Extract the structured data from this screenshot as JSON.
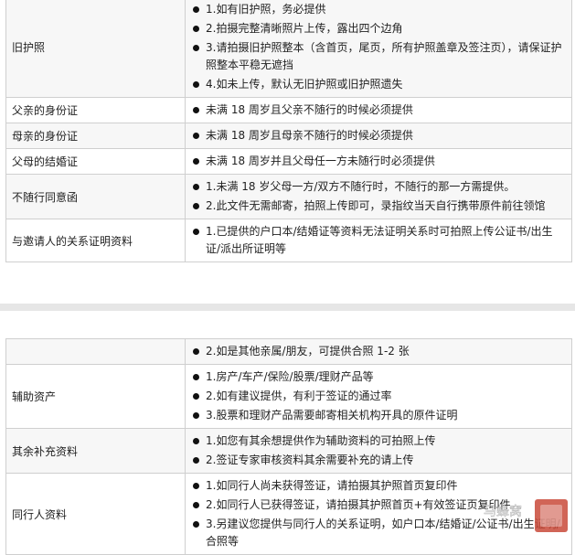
{
  "table1": {
    "rows": [
      {
        "label": "旧护照",
        "items": [
          "1.如有旧护照，务必提供",
          "2.拍摄完整清晰照片上传，露出四个边角",
          "3.请拍摄旧护照整本（含首页，尾页，所有护照盖章及签注页），请保证护照整本平稳无遮挡",
          "4.如未上传，默认无旧护照或旧护照遗失"
        ]
      },
      {
        "label": "父亲的身份证",
        "items": [
          "未满 18 周岁且父亲不随行的时候必须提供"
        ]
      },
      {
        "label": "母亲的身份证",
        "items": [
          "未满 18 周岁且母亲不随行的时候必须提供"
        ]
      },
      {
        "label": "父母的结婚证",
        "items": [
          "未满 18 周岁并且父母任一方未随行时必须提供"
        ]
      },
      {
        "label": "不随行同意函",
        "items": [
          "1.未满 18 岁父母一方/双方不随行时，不随行的那一方需提供。",
          "2.此文件无需邮寄，拍照上传即可，录指纹当天自行携带原件前往领馆"
        ]
      },
      {
        "label": "与邀请人的关系证明资料",
        "items": [
          "1.已提供的户口本/结婚证等资料无法证明关系时可拍照上传公证书/出生证/派出所证明等"
        ]
      }
    ]
  },
  "table2": {
    "rows": [
      {
        "label": "",
        "items": [
          "2.如是其他亲属/朋友，可提供合照 1-2 张"
        ]
      },
      {
        "label": "辅助资产",
        "items": [
          "1.房产/车产/保险/股票/理财产品等",
          "2.如有建议提供，有利于签证的通过率",
          "3.股票和理财产品需要邮寄相关机构开具的原件证明"
        ]
      },
      {
        "label": "其余补充资料",
        "items": [
          "1.如您有其余想提供作为辅助资料的可拍照上传",
          "2.签证专家审核资料其余需要补充的请上传"
        ]
      },
      {
        "label": "同行人资料",
        "items": [
          "1.如同行人尚未获得签证，请拍摄其护照首页复印件",
          "2.如同行人已获得签证，请拍摄其护照首页+有效签证页复印件",
          "3.另建议您提供与同行人的关系证明，如户口本/结婚证/公证书/出生证明/合照等"
        ]
      }
    ]
  },
  "watermark": {
    "text": "马蜂窝",
    "icon": "watermark-logo-icon"
  }
}
